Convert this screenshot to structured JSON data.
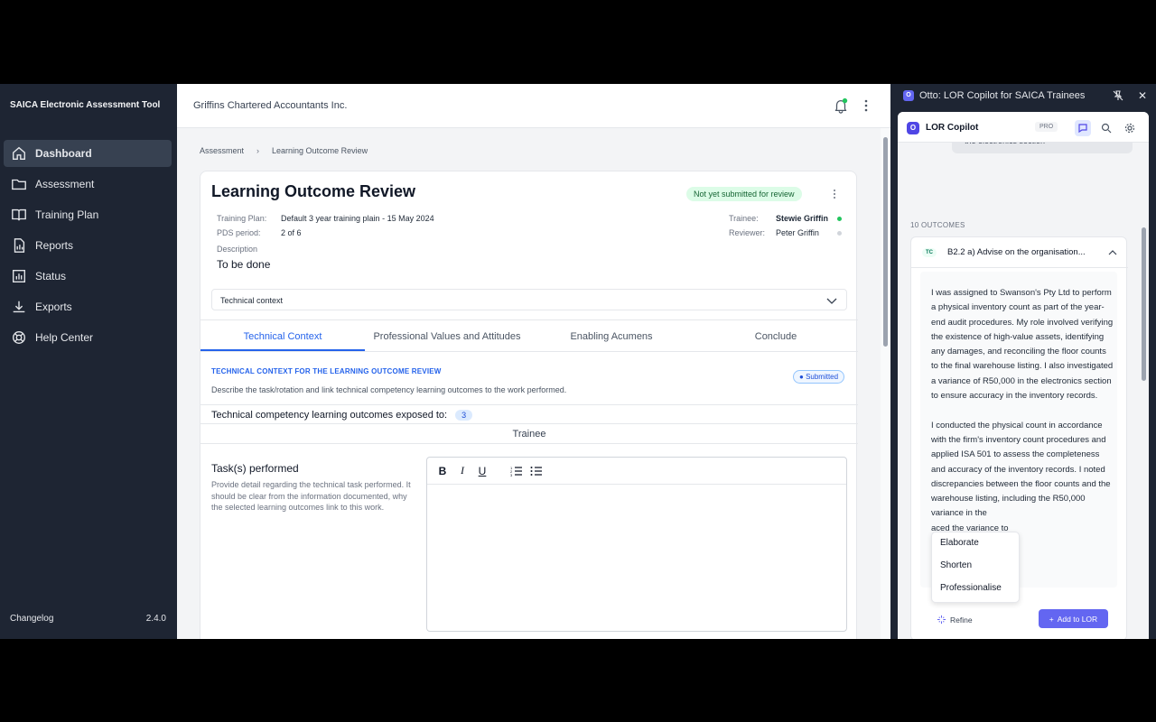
{
  "sidebar": {
    "app_title": "SAICA Electronic Assessment Tool",
    "items": [
      {
        "label": "Dashboard",
        "icon": "home-icon",
        "active": true
      },
      {
        "label": "Assessment",
        "icon": "folder-icon"
      },
      {
        "label": "Training Plan",
        "icon": "book-icon"
      },
      {
        "label": "Reports",
        "icon": "report-icon"
      },
      {
        "label": "Status",
        "icon": "chart-icon"
      },
      {
        "label": "Exports",
        "icon": "download-icon"
      },
      {
        "label": "Help Center",
        "icon": "help-icon"
      }
    ],
    "changelog": "Changelog",
    "version": "2.4.0"
  },
  "header": {
    "company": "Griffins Chartered Accountants Inc."
  },
  "breadcrumb": [
    "Assessment",
    "Learning Outcome Review"
  ],
  "review": {
    "title": "Learning Outcome Review",
    "status": "Not yet submitted for review",
    "training_plan_label": "Training Plan:",
    "training_plan_value": "Default 3 year training plain - 15 May 2024",
    "pds_label": "PDS period:",
    "pds_value": "2 of 6",
    "trainee_label": "Trainee:",
    "trainee_value": "Stewie Griffin",
    "reviewer_label": "Reviewer:",
    "reviewer_value": "Peter Griffin",
    "description_label": "Description",
    "description_value": "To be done",
    "dropdown": "Technical context",
    "tabs": [
      "Technical Context",
      "Professional Values and Attitudes",
      "Enabling Acumens",
      "Conclude"
    ],
    "section_title": "TECHNICAL CONTEXT FOR THE LEARNING OUTCOME REVIEW",
    "section_sub": "Describe the task/rotation and link technical competency learning outcomes to the work performed.",
    "submitted": "Submitted",
    "exposed_label": "Technical competency learning outcomes exposed to:",
    "exposed_count": "3",
    "trainee_col": "Trainee",
    "tasks_title": "Task(s) performed",
    "tasks_help": "Provide detail regarding the technical task performed. It should be clear from the information documented, why the selected learning outcomes link to this work.",
    "toolbar": {
      "bold": "B",
      "italic": "I",
      "underline": "U"
    }
  },
  "copilot": {
    "window_title": "Otto: LOR Copilot for SAICA Trainees",
    "panel_title": "LOR Copilot",
    "pro": "PRO",
    "prev_msg": "the electronics section",
    "outcomes_label": "10 OUTCOMES",
    "outcome_tag": "TC",
    "outcome_title": "B2.2 a) Advise on the organisation...",
    "outcome_text": "I was assigned to Swanson's Pty Ltd to perform a physical inventory count as part of the year-end audit procedures. My role involved verifying the existence of high-value assets, identifying any damages, and reconciling the floor counts to the final warehouse listing. I also investigated a variance of R50,000 in the electronics section to ensure accuracy in the inventory records.\n\nI conducted the physical count in accordance with the firm's inventory count procedures and applied ISA 501 to assess the completeness and accuracy of the inventory records. I noted discrepancies between the floor counts and the warehouse listing, including the R50,000 variance in the\n                    aced the variance to\n                    of goods to a third-\n                    djusted the records",
    "menu": [
      "Elaborate",
      "Shorten",
      "Professionalise"
    ],
    "refine": "Refine",
    "add": "Add to LOR"
  }
}
